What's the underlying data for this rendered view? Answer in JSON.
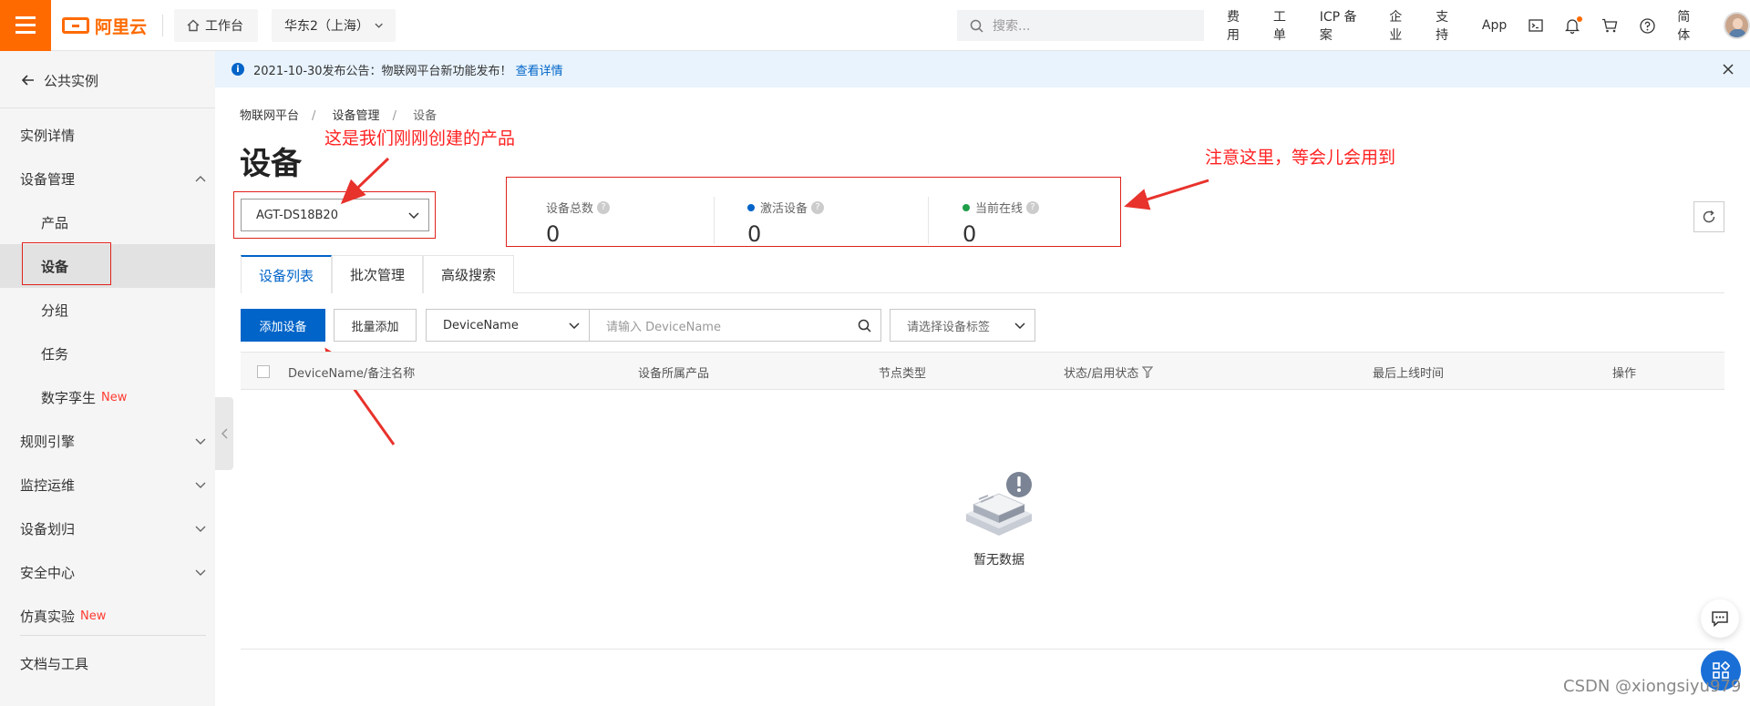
{
  "topbar": {
    "logo_text": "阿里云",
    "workbench": "工作台",
    "region": "华东2（上海）",
    "search_placeholder": "搜索...",
    "nav": [
      "费用",
      "工单",
      "ICP 备案",
      "企业",
      "支持",
      "App"
    ],
    "lang": "简体"
  },
  "sidebar": {
    "back_label": "公共实例",
    "items": [
      {
        "label": "实例详情"
      },
      {
        "label": "设备管理"
      },
      {
        "label": "产品"
      },
      {
        "label": "设备"
      },
      {
        "label": "分组"
      },
      {
        "label": "任务"
      },
      {
        "label": "数字孪生",
        "badge": "New"
      },
      {
        "label": "规则引擎"
      },
      {
        "label": "监控运维"
      },
      {
        "label": "设备划归"
      },
      {
        "label": "安全中心"
      },
      {
        "label": "仿真实验",
        "badge": "New"
      },
      {
        "label": "文档与工具"
      }
    ]
  },
  "notice": {
    "text": "2021-10-30发布公告：物联网平台新功能发布！",
    "link": "查看详情"
  },
  "breadcrumb": [
    "物联网平台",
    "设备管理",
    "设备"
  ],
  "page_title": "设备",
  "annotations": {
    "product": "这是我们刚刚创建的产品",
    "stats": "注意这里，等会儿会用到"
  },
  "product_select": "AGT-DS18B20",
  "stats": [
    {
      "label": "设备总数",
      "value": "0"
    },
    {
      "label": "激活设备",
      "value": "0",
      "dot_color": "#0064c8"
    },
    {
      "label": "当前在线",
      "value": "0",
      "dot_color": "#1e9e4a"
    }
  ],
  "tabs": [
    "设备列表",
    "批次管理",
    "高级搜索"
  ],
  "toolbar": {
    "add_device": "添加设备",
    "batch_add": "批量添加",
    "filter_field": "DeviceName",
    "search_placeholder": "请输入 DeviceName",
    "tag_placeholder": "请选择设备标签"
  },
  "table": {
    "headers": [
      "DeviceName/备注名称",
      "设备所属产品",
      "节点类型",
      "状态/启用状态",
      "最后上线时间",
      "操作"
    ]
  },
  "empty_text": "暂无数据",
  "watermark": "CSDN @xiongsiyu979",
  "colors": {
    "accent": "#ff6a00",
    "primary": "#0064c8",
    "annotation": "#ff2222"
  }
}
